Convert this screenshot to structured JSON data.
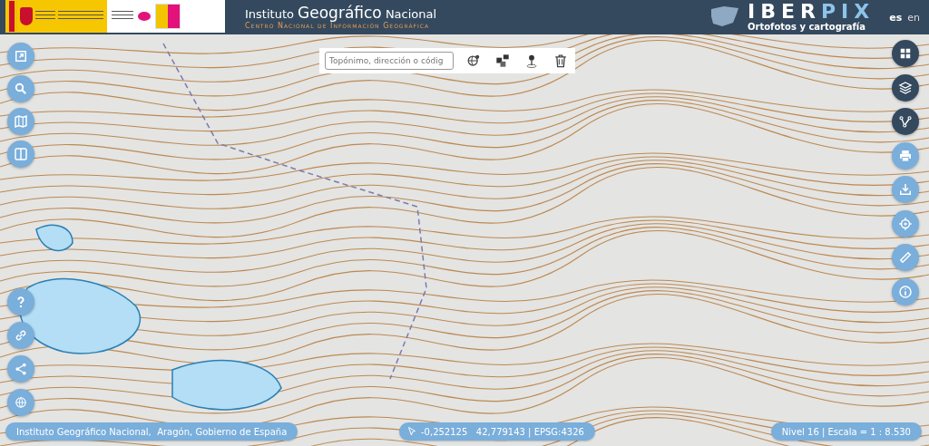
{
  "header": {
    "title": "Instituto **Geográfico** Nacional",
    "subtitle": "Centro Nacional de Información Geográfica",
    "brand": {
      "name_first": "IBER",
      "name_second": "PIX",
      "tagline": "Ortofotos y cartografía"
    },
    "languages": [
      {
        "label": "es",
        "selected": true
      },
      {
        "label": "en",
        "selected": false
      }
    ]
  },
  "search_toolbar": {
    "placeholder": "Topónimo, dirección o códig",
    "tools": [
      {
        "kind": "globe"
      },
      {
        "kind": "squares"
      },
      {
        "kind": "pin"
      },
      {
        "kind": "trash"
      }
    ]
  },
  "left_controls_top": [
    {
      "kind": "expand"
    },
    {
      "kind": "search"
    },
    {
      "kind": "map"
    },
    {
      "kind": "split"
    }
  ],
  "left_controls_bottom": [
    {
      "kind": "help"
    },
    {
      "kind": "link"
    },
    {
      "kind": "share"
    },
    {
      "kind": "globe"
    }
  ],
  "right_controls": [
    {
      "kind": "grid",
      "dark": true
    },
    {
      "kind": "layers",
      "dark": true
    },
    {
      "kind": "route",
      "dark": true
    },
    {
      "kind": "print",
      "dark": false
    },
    {
      "kind": "download",
      "dark": false
    },
    {
      "kind": "target",
      "dark": false
    },
    {
      "kind": "ruler",
      "dark": false
    },
    {
      "kind": "info",
      "dark": false
    }
  ],
  "status_bar": {
    "attribution": "Instituto Geográfico Nacional,  Aragón, Gobierno de España",
    "coordinates": "-0,252125   42,779143 | EPSG:4326",
    "scale": "Nivel 16 | Escala = 1 : 8.530"
  }
}
